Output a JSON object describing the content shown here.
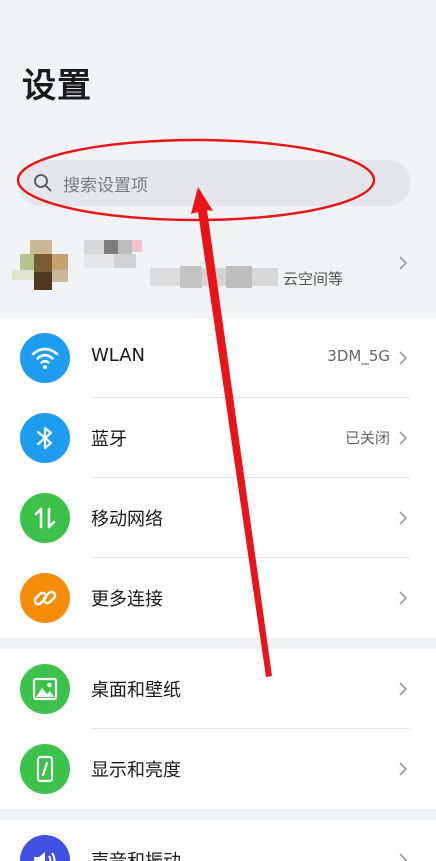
{
  "page": {
    "title": "设置"
  },
  "search": {
    "placeholder": "搜索设置项"
  },
  "account": {
    "subtitle": "云空间等"
  },
  "groups": [
    {
      "items": [
        {
          "label": "WLAN",
          "value": "3DM_5G",
          "icon": "wifi-icon",
          "color": "#1e9cf0"
        },
        {
          "label": "蓝牙",
          "value": "已关闭",
          "icon": "bluetooth-icon",
          "color": "#1e9cf0"
        },
        {
          "label": "移动网络",
          "value": "",
          "icon": "mobile-data-icon",
          "color": "#3cc14a"
        },
        {
          "label": "更多连接",
          "value": "",
          "icon": "link-icon",
          "color": "#f58d0a"
        }
      ]
    },
    {
      "items": [
        {
          "label": "桌面和壁纸",
          "value": "",
          "icon": "image-icon",
          "color": "#3cc14a"
        },
        {
          "label": "显示和亮度",
          "value": "",
          "icon": "phone-brightness-icon",
          "color": "#3cc14a"
        }
      ]
    },
    {
      "items": [
        {
          "label": "声音和振动",
          "value": "",
          "icon": "speaker-icon",
          "color": "#3f51e0"
        }
      ]
    }
  ],
  "colors": {
    "annotation": "#e8141a",
    "background": "#f1f3f5"
  }
}
